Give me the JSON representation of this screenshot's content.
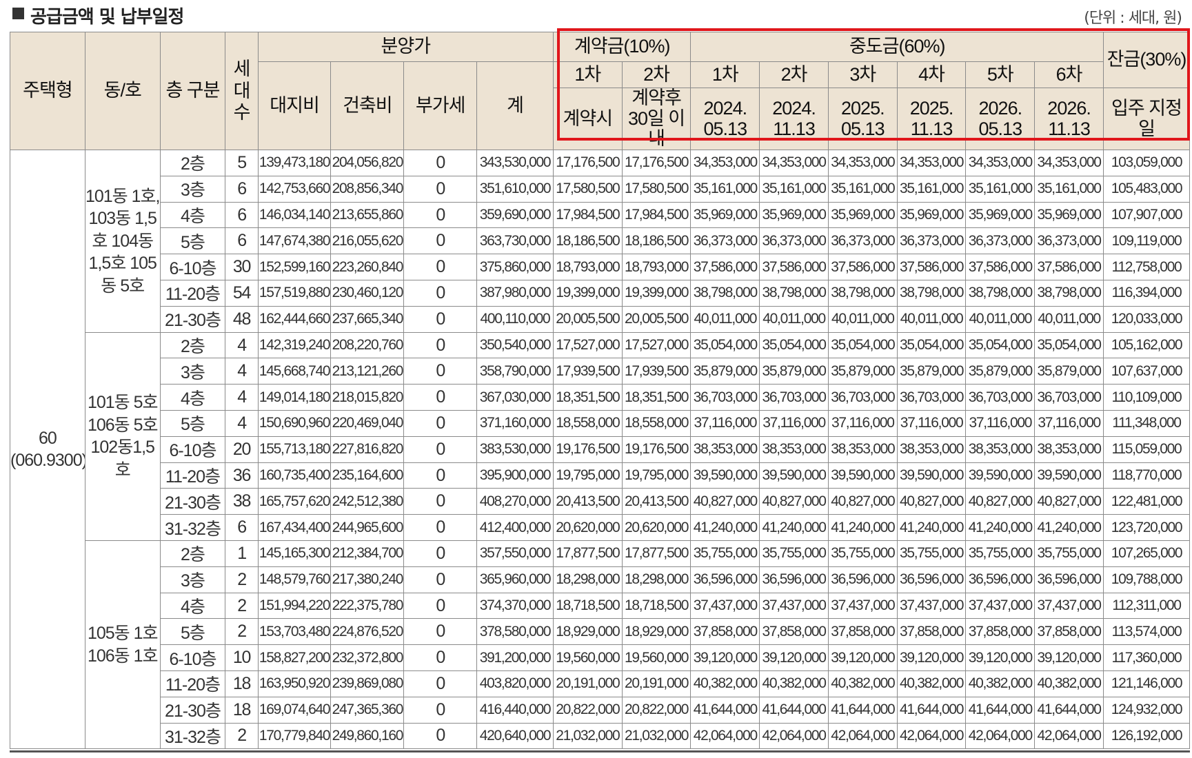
{
  "title": "공급금액 및 납부일정",
  "unit": "(단위 : 세대, 원)",
  "header": {
    "house_type": "주택형",
    "dong_ho": "동/호",
    "floor": "층 구분",
    "units": [
      "세",
      "대",
      "수"
    ],
    "sale_price": "분양가",
    "land": "대지비",
    "building": "건축비",
    "vat": "부가세",
    "total": "계",
    "contract": "계약금(10%)",
    "middle": "중도금(60%)",
    "balance": "잔금(30%)",
    "contract_1": "1차",
    "contract_2": "2차",
    "contract_1_date": "계약시",
    "contract_2_date": "계약후 30일 이내",
    "middle_rounds": [
      "1차",
      "2차",
      "3차",
      "4차",
      "5차",
      "6차"
    ],
    "middle_dates": [
      "2024. 05.13",
      "2024. 11.13",
      "2025. 05.13",
      "2025. 11.13",
      "2026. 05.13",
      "2026. 11.13"
    ],
    "balance_date": "입주 지정일"
  },
  "house_type_label": "60 (060.9300)",
  "groups": [
    {
      "dong_ho": "101동 1호, 103동 1,5호 104동 1,5호 105동 5호",
      "rows": [
        {
          "floor": "2층",
          "units": "5",
          "land": "139,473,180",
          "building": "204,056,820",
          "vat": "0",
          "total": "343,530,000",
          "c1": "17,176,500",
          "c2": "17,176,500",
          "m": "34,353,000",
          "bal": "103,059,000"
        },
        {
          "floor": "3층",
          "units": "6",
          "land": "142,753,660",
          "building": "208,856,340",
          "vat": "0",
          "total": "351,610,000",
          "c1": "17,580,500",
          "c2": "17,580,500",
          "m": "35,161,000",
          "bal": "105,483,000"
        },
        {
          "floor": "4층",
          "units": "6",
          "land": "146,034,140",
          "building": "213,655,860",
          "vat": "0",
          "total": "359,690,000",
          "c1": "17,984,500",
          "c2": "17,984,500",
          "m": "35,969,000",
          "bal": "107,907,000"
        },
        {
          "floor": "5층",
          "units": "6",
          "land": "147,674,380",
          "building": "216,055,620",
          "vat": "0",
          "total": "363,730,000",
          "c1": "18,186,500",
          "c2": "18,186,500",
          "m": "36,373,000",
          "bal": "109,119,000"
        },
        {
          "floor": "6-10층",
          "units": "30",
          "land": "152,599,160",
          "building": "223,260,840",
          "vat": "0",
          "total": "375,860,000",
          "c1": "18,793,000",
          "c2": "18,793,000",
          "m": "37,586,000",
          "bal": "112,758,000"
        },
        {
          "floor": "11-20층",
          "units": "54",
          "land": "157,519,880",
          "building": "230,460,120",
          "vat": "0",
          "total": "387,980,000",
          "c1": "19,399,000",
          "c2": "19,399,000",
          "m": "38,798,000",
          "bal": "116,394,000"
        },
        {
          "floor": "21-30층",
          "units": "48",
          "land": "162,444,660",
          "building": "237,665,340",
          "vat": "0",
          "total": "400,110,000",
          "c1": "20,005,500",
          "c2": "20,005,500",
          "m": "40,011,000",
          "bal": "120,033,000"
        }
      ]
    },
    {
      "dong_ho": "101동 5호 106동 5호 102동1,5호",
      "rows": [
        {
          "floor": "2층",
          "units": "4",
          "land": "142,319,240",
          "building": "208,220,760",
          "vat": "0",
          "total": "350,540,000",
          "c1": "17,527,000",
          "c2": "17,527,000",
          "m": "35,054,000",
          "bal": "105,162,000"
        },
        {
          "floor": "3층",
          "units": "4",
          "land": "145,668,740",
          "building": "213,121,260",
          "vat": "0",
          "total": "358,790,000",
          "c1": "17,939,500",
          "c2": "17,939,500",
          "m": "35,879,000",
          "bal": "107,637,000"
        },
        {
          "floor": "4층",
          "units": "4",
          "land": "149,014,180",
          "building": "218,015,820",
          "vat": "0",
          "total": "367,030,000",
          "c1": "18,351,500",
          "c2": "18,351,500",
          "m": "36,703,000",
          "bal": "110,109,000"
        },
        {
          "floor": "5층",
          "units": "4",
          "land": "150,690,960",
          "building": "220,469,040",
          "vat": "0",
          "total": "371,160,000",
          "c1": "18,558,000",
          "c2": "18,558,000",
          "m": "37,116,000",
          "bal": "111,348,000"
        },
        {
          "floor": "6-10층",
          "units": "20",
          "land": "155,713,180",
          "building": "227,816,820",
          "vat": "0",
          "total": "383,530,000",
          "c1": "19,176,500",
          "c2": "19,176,500",
          "m": "38,353,000",
          "bal": "115,059,000"
        },
        {
          "floor": "11-20층",
          "units": "36",
          "land": "160,735,400",
          "building": "235,164,600",
          "vat": "0",
          "total": "395,900,000",
          "c1": "19,795,000",
          "c2": "19,795,000",
          "m": "39,590,000",
          "bal": "118,770,000"
        },
        {
          "floor": "21-30층",
          "units": "38",
          "land": "165,757,620",
          "building": "242,512,380",
          "vat": "0",
          "total": "408,270,000",
          "c1": "20,413,500",
          "c2": "20,413,500",
          "m": "40,827,000",
          "bal": "122,481,000"
        },
        {
          "floor": "31-32층",
          "units": "6",
          "land": "167,434,400",
          "building": "244,965,600",
          "vat": "0",
          "total": "412,400,000",
          "c1": "20,620,000",
          "c2": "20,620,000",
          "m": "41,240,000",
          "bal": "123,720,000"
        }
      ]
    },
    {
      "dong_ho": "105동 1호 106동 1호",
      "rows": [
        {
          "floor": "2층",
          "units": "1",
          "land": "145,165,300",
          "building": "212,384,700",
          "vat": "0",
          "total": "357,550,000",
          "c1": "17,877,500",
          "c2": "17,877,500",
          "m": "35,755,000",
          "bal": "107,265,000"
        },
        {
          "floor": "3층",
          "units": "2",
          "land": "148,579,760",
          "building": "217,380,240",
          "vat": "0",
          "total": "365,960,000",
          "c1": "18,298,000",
          "c2": "18,298,000",
          "m": "36,596,000",
          "bal": "109,788,000"
        },
        {
          "floor": "4층",
          "units": "2",
          "land": "151,994,220",
          "building": "222,375,780",
          "vat": "0",
          "total": "374,370,000",
          "c1": "18,718,500",
          "c2": "18,718,500",
          "m": "37,437,000",
          "bal": "112,311,000"
        },
        {
          "floor": "5층",
          "units": "2",
          "land": "153,703,480",
          "building": "224,876,520",
          "vat": "0",
          "total": "378,580,000",
          "c1": "18,929,000",
          "c2": "18,929,000",
          "m": "37,858,000",
          "bal": "113,574,000"
        },
        {
          "floor": "6-10층",
          "units": "10",
          "land": "158,827,200",
          "building": "232,372,800",
          "vat": "0",
          "total": "391,200,000",
          "c1": "19,560,000",
          "c2": "19,560,000",
          "m": "39,120,000",
          "bal": "117,360,000"
        },
        {
          "floor": "11-20층",
          "units": "18",
          "land": "163,950,920",
          "building": "239,869,080",
          "vat": "0",
          "total": "403,820,000",
          "c1": "20,191,000",
          "c2": "20,191,000",
          "m": "40,382,000",
          "bal": "121,146,000"
        },
        {
          "floor": "21-30층",
          "units": "18",
          "land": "169,074,640",
          "building": "247,365,360",
          "vat": "0",
          "total": "416,440,000",
          "c1": "20,822,000",
          "c2": "20,822,000",
          "m": "41,644,000",
          "bal": "124,932,000"
        },
        {
          "floor": "31-32층",
          "units": "2",
          "land": "170,779,840",
          "building": "249,860,160",
          "vat": "0",
          "total": "420,640,000",
          "c1": "21,032,000",
          "c2": "21,032,000",
          "m": "42,064,000",
          "bal": "126,192,000"
        }
      ]
    }
  ],
  "colors": {
    "header_bg": "#ede3d3",
    "highlight": "#e0161b",
    "grid": "#8a8a8a"
  }
}
